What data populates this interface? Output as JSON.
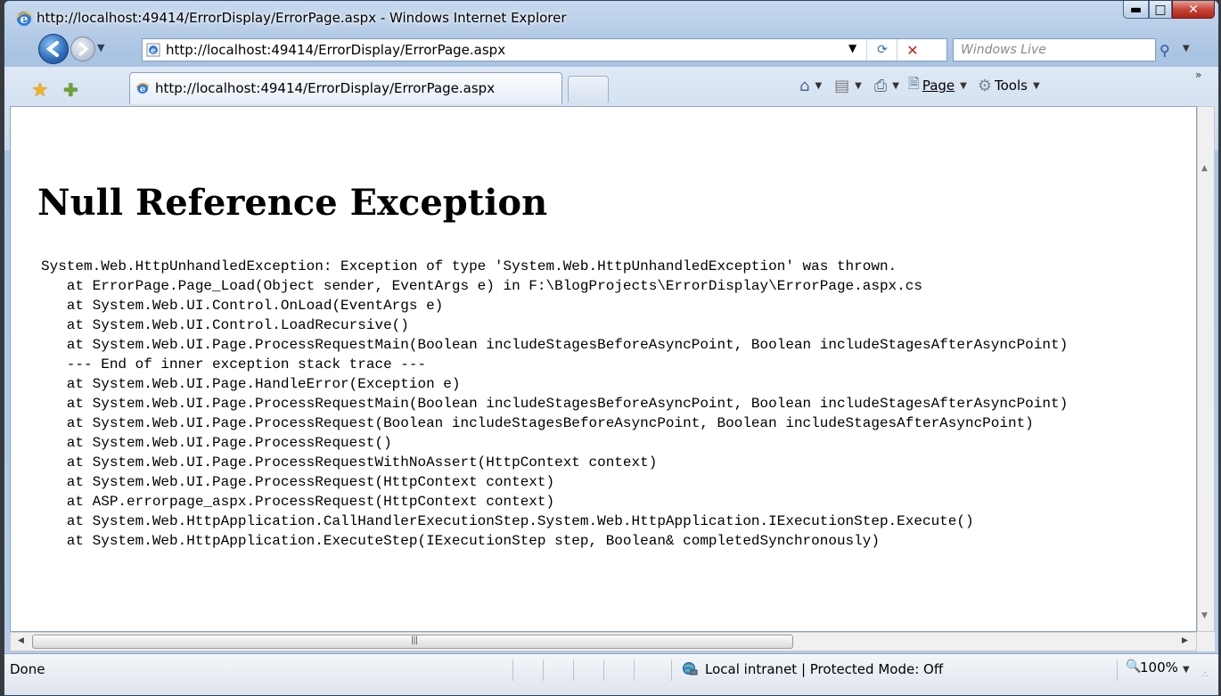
{
  "window": {
    "title": "http://localhost:49414/ErrorDisplay/ErrorPage.aspx - Windows Internet Explorer"
  },
  "address_bar": {
    "url": "http://localhost:49414/ErrorDisplay/ErrorPage.aspx"
  },
  "search": {
    "placeholder": "Windows Live"
  },
  "tab": {
    "label": "http://localhost:49414/ErrorDisplay/ErrorPage.aspx"
  },
  "commands": {
    "page_label": "Page",
    "tools_label": "Tools"
  },
  "page": {
    "heading": "Null Reference Exception",
    "stack_trace": [
      "System.Web.HttpUnhandledException: Exception of type 'System.Web.HttpUnhandledException' was thrown.",
      "   at ErrorPage.Page_Load(Object sender, EventArgs e) in F:\\BlogProjects\\ErrorDisplay\\ErrorPage.aspx.cs",
      "   at System.Web.UI.Control.OnLoad(EventArgs e)",
      "   at System.Web.UI.Control.LoadRecursive()",
      "   at System.Web.UI.Page.ProcessRequestMain(Boolean includeStagesBeforeAsyncPoint, Boolean includeStagesAfterAsyncPoint)",
      "   --- End of inner exception stack trace ---",
      "   at System.Web.UI.Page.HandleError(Exception e)",
      "   at System.Web.UI.Page.ProcessRequestMain(Boolean includeStagesBeforeAsyncPoint, Boolean includeStagesAfterAsyncPoint)",
      "   at System.Web.UI.Page.ProcessRequest(Boolean includeStagesBeforeAsyncPoint, Boolean includeStagesAfterAsyncPoint)",
      "   at System.Web.UI.Page.ProcessRequest()",
      "   at System.Web.UI.Page.ProcessRequestWithNoAssert(HttpContext context)",
      "   at System.Web.UI.Page.ProcessRequest(HttpContext context)",
      "   at ASP.errorpage_aspx.ProcessRequest(HttpContext context)",
      "   at System.Web.HttpApplication.CallHandlerExecutionStep.System.Web.HttpApplication.IExecutionStep.Execute()",
      "   at System.Web.HttpApplication.ExecuteStep(IExecutionStep step, Boolean& completedSynchronously)"
    ]
  },
  "status_bar": {
    "status": "Done",
    "zone": "Local intranet | Protected Mode: Off",
    "zoom": "100%"
  },
  "icons": {
    "back": "back-arrow-icon",
    "forward": "forward-arrow-icon",
    "refresh": "refresh-icon",
    "stop": "stop-icon",
    "search": "search-icon",
    "favorites": "favorites-star-icon",
    "add_favorite": "add-favorite-icon",
    "home": "home-icon",
    "feeds": "feeds-icon",
    "print": "print-icon",
    "page": "page-icon",
    "tools": "gear-icon",
    "zone": "intranet-globe-icon",
    "zoom": "zoom-icon"
  }
}
